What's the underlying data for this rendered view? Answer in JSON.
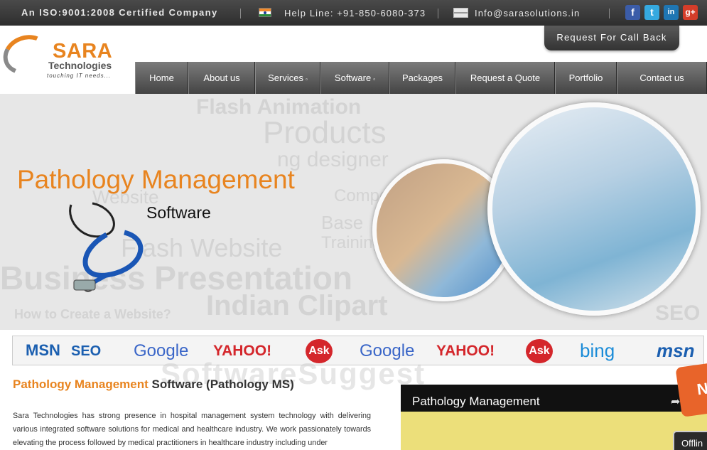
{
  "topbar": {
    "certification": "An ISO:9001:2008 Certified Company",
    "helpline": "Help Line: +91-850-6080-373",
    "email": "Info@sarasolutions.in",
    "social": [
      {
        "name": "facebook-icon",
        "label": "f"
      },
      {
        "name": "twitter-icon",
        "label": "t"
      },
      {
        "name": "linkedin-icon",
        "label": "in"
      },
      {
        "name": "google-plus-icon",
        "label": "g+"
      }
    ]
  },
  "callback_label": "Request For Call Back",
  "logo": {
    "name": "SARA",
    "sub": "Technologies",
    "tagline": "touching IT needs..."
  },
  "nav": [
    {
      "label": "Home",
      "dropdown": false
    },
    {
      "label": "About us",
      "dropdown": false
    },
    {
      "label": "Services",
      "dropdown": true
    },
    {
      "label": "Software",
      "dropdown": true
    },
    {
      "label": "Packages",
      "dropdown": false
    },
    {
      "label": "Request a Quote",
      "dropdown": false
    },
    {
      "label": "Portfolio",
      "dropdown": false
    },
    {
      "label": "Contact us",
      "dropdown": false
    }
  ],
  "banner": {
    "title": "Pathology Management",
    "subtitle": "Software",
    "background_words": [
      "Flash Animation",
      "Products",
      "ng designer",
      "Website",
      "Flash Website",
      "Business Presentation",
      "Indian Clipart",
      "How to Create a Website?",
      "Base",
      "Training",
      "SEO",
      "Compe"
    ]
  },
  "brands": [
    {
      "label": "MSN",
      "color": "#1b5fb0"
    },
    {
      "label": "SEO",
      "color": "#1b5fb0"
    },
    {
      "label": "Google",
      "color": "#3a66c8"
    },
    {
      "label": "YAHOO!",
      "color": "#d4262b"
    },
    {
      "label": "Ask",
      "color": "#d4262b"
    },
    {
      "label": "Google",
      "color": "#3a66c8"
    },
    {
      "label": "YAHOO!",
      "color": "#d4262b"
    },
    {
      "label": "Ask",
      "color": "#d4262b"
    },
    {
      "label": "bing",
      "color": "#1b8cd8"
    },
    {
      "label": "msn",
      "color": "#1b5fb0"
    }
  ],
  "content": {
    "heading_accent": "Pathology Management",
    "heading_rest": " Software (Pathology MS)",
    "paragraph": "Sara Technologies has strong presence in hospital management system technology with delivering various integrated software solutions for medical and healthcare industry. We work passionately towards elevating the process followed by medical practitioners in healthcare industry including under",
    "watermark": "SoftwareSuggest"
  },
  "video": {
    "title": "Pathology Management"
  },
  "offline_label": "Offlin",
  "colors": {
    "accent": "#e8841f",
    "nav": "#5a5a5a",
    "topbar": "#3a3a3a"
  }
}
